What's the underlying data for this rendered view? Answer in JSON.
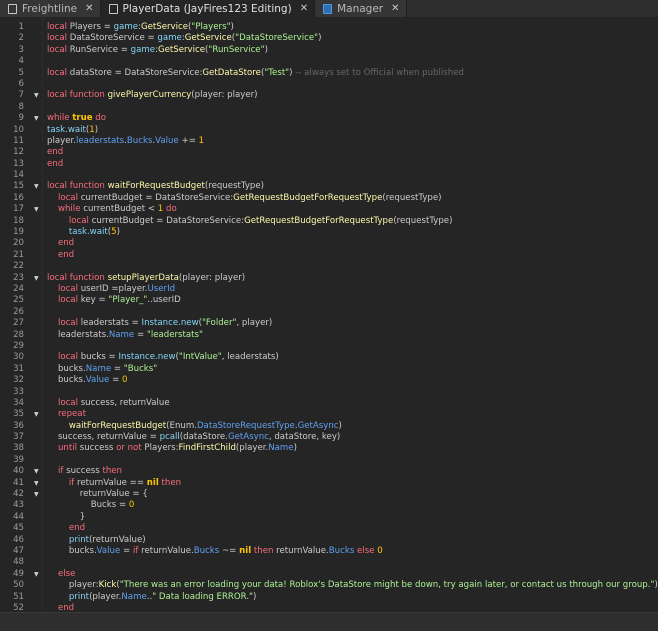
{
  "tabs": [
    {
      "label": "Freightline",
      "close": "✕",
      "icon": "script-icon",
      "active": false
    },
    {
      "label": "PlayerData (JayFires123 Editing)",
      "close": "✕",
      "icon": "document-icon",
      "active": true
    },
    {
      "label": "Manager",
      "close": "✕",
      "icon": "module-script-icon",
      "active": false
    }
  ],
  "colors": {
    "keyword": "#f86d7c",
    "builtin": "#84d6f7",
    "function": "#fdfbac",
    "string": "#adf195",
    "number": "#ffc600",
    "property": "#61a1f1",
    "comment": "#666666",
    "text": "#cccccc",
    "background": "#252525"
  },
  "code": [
    {
      "n": "1",
      "t": [
        [
          "k",
          "local"
        ],
        [
          "t",
          " Players = "
        ],
        [
          "b",
          "game"
        ],
        [
          "t",
          ":"
        ],
        [
          "f",
          "GetService"
        ],
        [
          "t",
          "("
        ],
        [
          "s",
          "\"Players\""
        ],
        [
          "t",
          ")"
        ]
      ]
    },
    {
      "n": "2",
      "t": [
        [
          "k",
          "local"
        ],
        [
          "t",
          " DataStoreService = "
        ],
        [
          "b",
          "game"
        ],
        [
          "t",
          ":"
        ],
        [
          "f",
          "GetService"
        ],
        [
          "t",
          "("
        ],
        [
          "s",
          "\"DataStoreService\""
        ],
        [
          "t",
          ")"
        ]
      ]
    },
    {
      "n": "3",
      "t": [
        [
          "k",
          "local"
        ],
        [
          "t",
          " RunService = "
        ],
        [
          "b",
          "game"
        ],
        [
          "t",
          ":"
        ],
        [
          "f",
          "GetService"
        ],
        [
          "t",
          "("
        ],
        [
          "s",
          "\"RunService\""
        ],
        [
          "t",
          ")"
        ]
      ]
    },
    {
      "n": "4",
      "t": []
    },
    {
      "n": "5",
      "t": [
        [
          "k",
          "local"
        ],
        [
          "t",
          " dataStore = DataStoreService:"
        ],
        [
          "f",
          "GetDataStore"
        ],
        [
          "t",
          "("
        ],
        [
          "s",
          "\"Test\""
        ],
        [
          "t",
          ") "
        ],
        [
          "c",
          "-- always set to Official when published"
        ]
      ]
    },
    {
      "n": "6",
      "t": []
    },
    {
      "n": "7",
      "fold": true,
      "t": [
        [
          "k",
          "local function"
        ],
        [
          "f",
          " givePlayerCurrency"
        ],
        [
          "t",
          "(player: player)"
        ]
      ]
    },
    {
      "n": "8",
      "t": []
    },
    {
      "n": "9",
      "fold": true,
      "t": [
        [
          "k",
          "while "
        ],
        [
          "y",
          "true"
        ],
        [
          "k",
          " do"
        ]
      ]
    },
    {
      "n": "10",
      "t": [
        [
          "b",
          "task.wait"
        ],
        [
          "t",
          "("
        ],
        [
          "n",
          "1"
        ],
        [
          "t",
          ")"
        ]
      ]
    },
    {
      "n": "11",
      "t": [
        [
          "t",
          "player."
        ],
        [
          "p",
          "leaderstats"
        ],
        [
          "t",
          "."
        ],
        [
          "p",
          "Bucks"
        ],
        [
          "t",
          "."
        ],
        [
          "p",
          "Value"
        ],
        [
          "t",
          " += "
        ],
        [
          "n",
          "1"
        ]
      ]
    },
    {
      "n": "12",
      "t": [
        [
          "k",
          "end"
        ]
      ]
    },
    {
      "n": "13",
      "t": [
        [
          "k",
          "end"
        ]
      ]
    },
    {
      "n": "14",
      "t": []
    },
    {
      "n": "15",
      "fold": true,
      "t": [
        [
          "k",
          "local function "
        ],
        [
          "f",
          "waitForRequestBudget"
        ],
        [
          "t",
          "(requestType)"
        ]
      ]
    },
    {
      "n": "16",
      "t": [
        [
          "t",
          "\t"
        ],
        [
          "k",
          "local"
        ],
        [
          "t",
          " currentBudget = DataStoreService:"
        ],
        [
          "f",
          "GetRequestBudgetForRequestType"
        ],
        [
          "t",
          "(requestType)"
        ]
      ]
    },
    {
      "n": "17",
      "fold": true,
      "t": [
        [
          "t",
          "\t"
        ],
        [
          "k",
          "while"
        ],
        [
          "t",
          " currentBudget < "
        ],
        [
          "n",
          "1"
        ],
        [
          "k",
          " do"
        ]
      ]
    },
    {
      "n": "18",
      "t": [
        [
          "t",
          "\t\t"
        ],
        [
          "k",
          "local"
        ],
        [
          "t",
          " currentBudget = DataStoreService:"
        ],
        [
          "f",
          "GetRequestBudgetForRequestType"
        ],
        [
          "t",
          "(requestType)"
        ]
      ]
    },
    {
      "n": "19",
      "t": [
        [
          "t",
          "\t\t"
        ],
        [
          "b",
          "task.wait"
        ],
        [
          "t",
          "("
        ],
        [
          "n",
          "5"
        ],
        [
          "t",
          ")"
        ]
      ]
    },
    {
      "n": "20",
      "t": [
        [
          "t",
          "\t"
        ],
        [
          "k",
          "end"
        ]
      ]
    },
    {
      "n": "21",
      "t": [
        [
          "t",
          "\t"
        ],
        [
          "k",
          "end"
        ]
      ]
    },
    {
      "n": "22",
      "t": []
    },
    {
      "n": "23",
      "fold": true,
      "t": [
        [
          "k",
          "local function "
        ],
        [
          "f",
          "setupPlayerData"
        ],
        [
          "t",
          "(player: player)"
        ]
      ]
    },
    {
      "n": "24",
      "t": [
        [
          "t",
          "\t"
        ],
        [
          "k",
          "local"
        ],
        [
          "t",
          " userID =player."
        ],
        [
          "p",
          "UserId"
        ]
      ]
    },
    {
      "n": "25",
      "t": [
        [
          "t",
          "\t"
        ],
        [
          "k",
          "local"
        ],
        [
          "t",
          " key = "
        ],
        [
          "s",
          "\"Player_\""
        ],
        [
          "t",
          "..userID"
        ]
      ]
    },
    {
      "n": "26",
      "t": []
    },
    {
      "n": "27",
      "t": [
        [
          "t",
          "\t"
        ],
        [
          "k",
          "local"
        ],
        [
          "t",
          " leaderstats = "
        ],
        [
          "b",
          "Instance.new"
        ],
        [
          "t",
          "("
        ],
        [
          "s",
          "\"Folder\""
        ],
        [
          "t",
          ", player)"
        ]
      ]
    },
    {
      "n": "28",
      "t": [
        [
          "t",
          "\tleaderstats."
        ],
        [
          "p",
          "Name"
        ],
        [
          "t",
          " = "
        ],
        [
          "s",
          "\"leaderstats\""
        ]
      ]
    },
    {
      "n": "29",
      "t": []
    },
    {
      "n": "30",
      "t": [
        [
          "t",
          "\t"
        ],
        [
          "k",
          "local"
        ],
        [
          "t",
          " bucks = "
        ],
        [
          "b",
          "Instance.new"
        ],
        [
          "t",
          "("
        ],
        [
          "s",
          "\"IntValue\""
        ],
        [
          "t",
          ", leaderstats)"
        ]
      ]
    },
    {
      "n": "31",
      "t": [
        [
          "t",
          "\tbucks."
        ],
        [
          "p",
          "Name"
        ],
        [
          "t",
          " = "
        ],
        [
          "s",
          "\"Bucks\""
        ]
      ]
    },
    {
      "n": "32",
      "t": [
        [
          "t",
          "\tbucks."
        ],
        [
          "p",
          "Value"
        ],
        [
          "t",
          " = "
        ],
        [
          "n",
          "0"
        ]
      ]
    },
    {
      "n": "33",
      "t": []
    },
    {
      "n": "34",
      "t": [
        [
          "t",
          "\t"
        ],
        [
          "k",
          "local"
        ],
        [
          "t",
          " success, returnValue"
        ]
      ]
    },
    {
      "n": "35",
      "fold": true,
      "t": [
        [
          "t",
          "\t"
        ],
        [
          "k",
          "repeat"
        ]
      ]
    },
    {
      "n": "36",
      "t": [
        [
          "t",
          "\t\t"
        ],
        [
          "f",
          "waitForRequestBudget"
        ],
        [
          "t",
          "(Enum."
        ],
        [
          "p",
          "DataStoreRequestType"
        ],
        [
          "t",
          "."
        ],
        [
          "p",
          "GetAsync"
        ],
        [
          "t",
          ")"
        ]
      ]
    },
    {
      "n": "37",
      "t": [
        [
          "t",
          "\tsuccess, returnValue = "
        ],
        [
          "b",
          "pcall"
        ],
        [
          "t",
          "(dataStore."
        ],
        [
          "p",
          "GetAsync"
        ],
        [
          "t",
          ", dataStore, key)"
        ]
      ]
    },
    {
      "n": "38",
      "t": [
        [
          "t",
          "\t"
        ],
        [
          "k",
          "until"
        ],
        [
          "t",
          " success "
        ],
        [
          "k",
          "or not"
        ],
        [
          "t",
          " Players:"
        ],
        [
          "f",
          "FindFirstChild"
        ],
        [
          "t",
          "(player."
        ],
        [
          "p",
          "Name"
        ],
        [
          "t",
          ")"
        ]
      ]
    },
    {
      "n": "39",
      "t": []
    },
    {
      "n": "40",
      "fold": true,
      "t": [
        [
          "t",
          "\t"
        ],
        [
          "k",
          "if"
        ],
        [
          "t",
          " success "
        ],
        [
          "k",
          "then"
        ]
      ]
    },
    {
      "n": "41",
      "fold": true,
      "t": [
        [
          "t",
          "\t\t"
        ],
        [
          "k",
          "if"
        ],
        [
          "t",
          " returnValue == "
        ],
        [
          "y",
          "nil"
        ],
        [
          "k",
          " then"
        ]
      ]
    },
    {
      "n": "42",
      "fold": true,
      "t": [
        [
          "t",
          "\t\t\treturnValue = {"
        ]
      ]
    },
    {
      "n": "43",
      "t": [
        [
          "t",
          "\t\t\t\tBucks = "
        ],
        [
          "n",
          "0"
        ]
      ]
    },
    {
      "n": "44",
      "t": [
        [
          "t",
          "\t\t\t}"
        ]
      ]
    },
    {
      "n": "45",
      "t": [
        [
          "t",
          "\t\t"
        ],
        [
          "k",
          "end"
        ]
      ]
    },
    {
      "n": "46",
      "t": [
        [
          "t",
          "\t\t"
        ],
        [
          "b",
          "print"
        ],
        [
          "t",
          "(returnValue)"
        ]
      ]
    },
    {
      "n": "47",
      "t": [
        [
          "t",
          "\t\tbucks."
        ],
        [
          "p",
          "Value"
        ],
        [
          "t",
          " = "
        ],
        [
          "k",
          "if"
        ],
        [
          "t",
          " returnValue."
        ],
        [
          "p",
          "Bucks"
        ],
        [
          "t",
          " ~= "
        ],
        [
          "y",
          "nil"
        ],
        [
          "k",
          " then"
        ],
        [
          "t",
          " returnValue."
        ],
        [
          "p",
          "Bucks"
        ],
        [
          "k",
          " else"
        ],
        [
          "n",
          " 0"
        ]
      ]
    },
    {
      "n": "48",
      "t": []
    },
    {
      "n": "49",
      "fold": true,
      "t": [
        [
          "t",
          "\t"
        ],
        [
          "k",
          "else"
        ]
      ]
    },
    {
      "n": "50",
      "t": [
        [
          "t",
          "\t\tplayer:"
        ],
        [
          "f",
          "Kick"
        ],
        [
          "t",
          "("
        ],
        [
          "s",
          "\"There was an error loading your data! Roblox's DataStore might be down, try again later, or contact us through our group.\""
        ],
        [
          "t",
          ")"
        ]
      ]
    },
    {
      "n": "51",
      "t": [
        [
          "t",
          "\t\t"
        ],
        [
          "b",
          "print"
        ],
        [
          "t",
          "(player."
        ],
        [
          "p",
          "Name"
        ],
        [
          "t",
          ".."
        ],
        [
          "s",
          "\" Data loading ERROR.\""
        ],
        [
          "t",
          ")"
        ]
      ]
    },
    {
      "n": "52",
      "t": [
        [
          "t",
          "\t"
        ],
        [
          "k",
          "end"
        ]
      ]
    }
  ]
}
